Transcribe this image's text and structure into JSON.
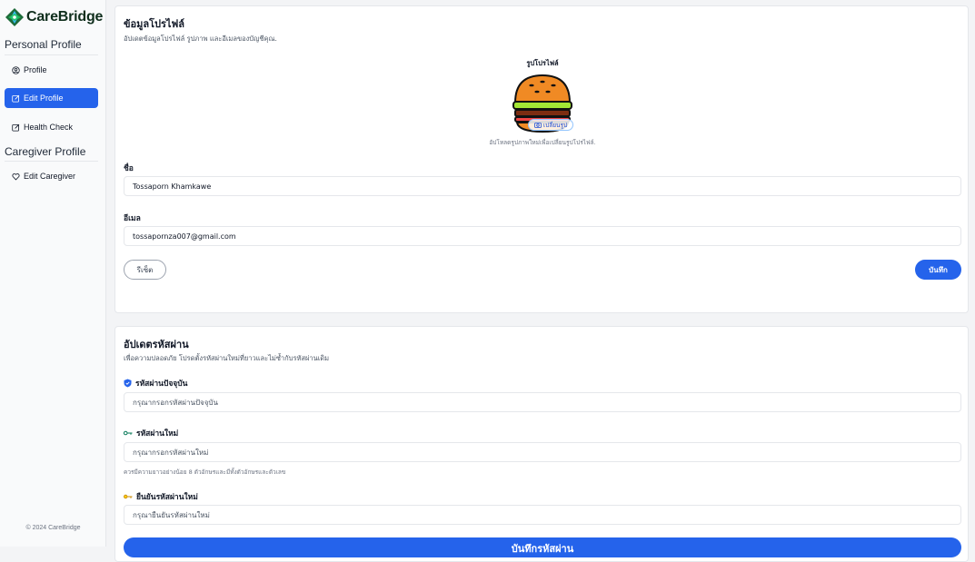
{
  "app": {
    "name": "CareBridge",
    "footer": "© 2024 CareBridge"
  },
  "sidebar": {
    "personal_title": "Personal Profile",
    "caregiver_title": "Caregiver Profile",
    "items": [
      {
        "label": "Profile",
        "icon": "user-circle-icon",
        "active": false
      },
      {
        "label": "Edit Profile",
        "icon": "edit-icon",
        "active": true
      },
      {
        "label": "Health Check",
        "icon": "edit-icon",
        "active": false
      },
      {
        "label": "Edit Caregiver",
        "icon": "heart-icon",
        "active": false
      }
    ]
  },
  "profile": {
    "title": "ข้อมูลโปรไฟล์",
    "subtitle": "อัปเดตข้อมูลโปรไฟล์ รูปภาพ และอีเมลของบัญชีคุณ.",
    "avatar_label": "รูปโปรไฟล์",
    "change_photo": "เปลี่ยนรูป",
    "upload_hint": "อัปโหลดรูปภาพใหม่เพื่อเปลี่ยนรูปโปรไฟล์.",
    "name_label": "ชื่อ",
    "name_value": "Tossaporn Khamkawe",
    "email_label": "อีเมล",
    "email_value": "tossapornza007@gmail.com",
    "reset_label": "รีเซ็ต",
    "save_label": "บันทึก"
  },
  "password": {
    "title": "อัปเดตรหัสผ่าน",
    "subtitle": "เพื่อความปลอดภัย โปรดตั้งรหัสผ่านใหม่ที่ยาวและไม่ซ้ำกับรหัสผ่านเดิม",
    "current_label": "รหัสผ่านปัจจุบัน",
    "current_placeholder": "กรุณากรอกรหัสผ่านปัจจุบัน",
    "new_label": "รหัสผ่านใหม่",
    "new_placeholder": "กรุณากรอกรหัสผ่านใหม่",
    "new_hint": "ควรมีความยาวอย่างน้อย 8 ตัวอักษรและมีทั้งตัวอักษรและตัวเลข",
    "confirm_label": "ยืนยันรหัสผ่านใหม่",
    "confirm_placeholder": "กรุณายืนยันรหัสผ่านใหม่",
    "submit_label": "บันทึกรหัสผ่าน"
  },
  "colors": {
    "accent": "#2563eb",
    "brand_green": "#16a34a",
    "brand_blue": "#0ea5e9"
  }
}
